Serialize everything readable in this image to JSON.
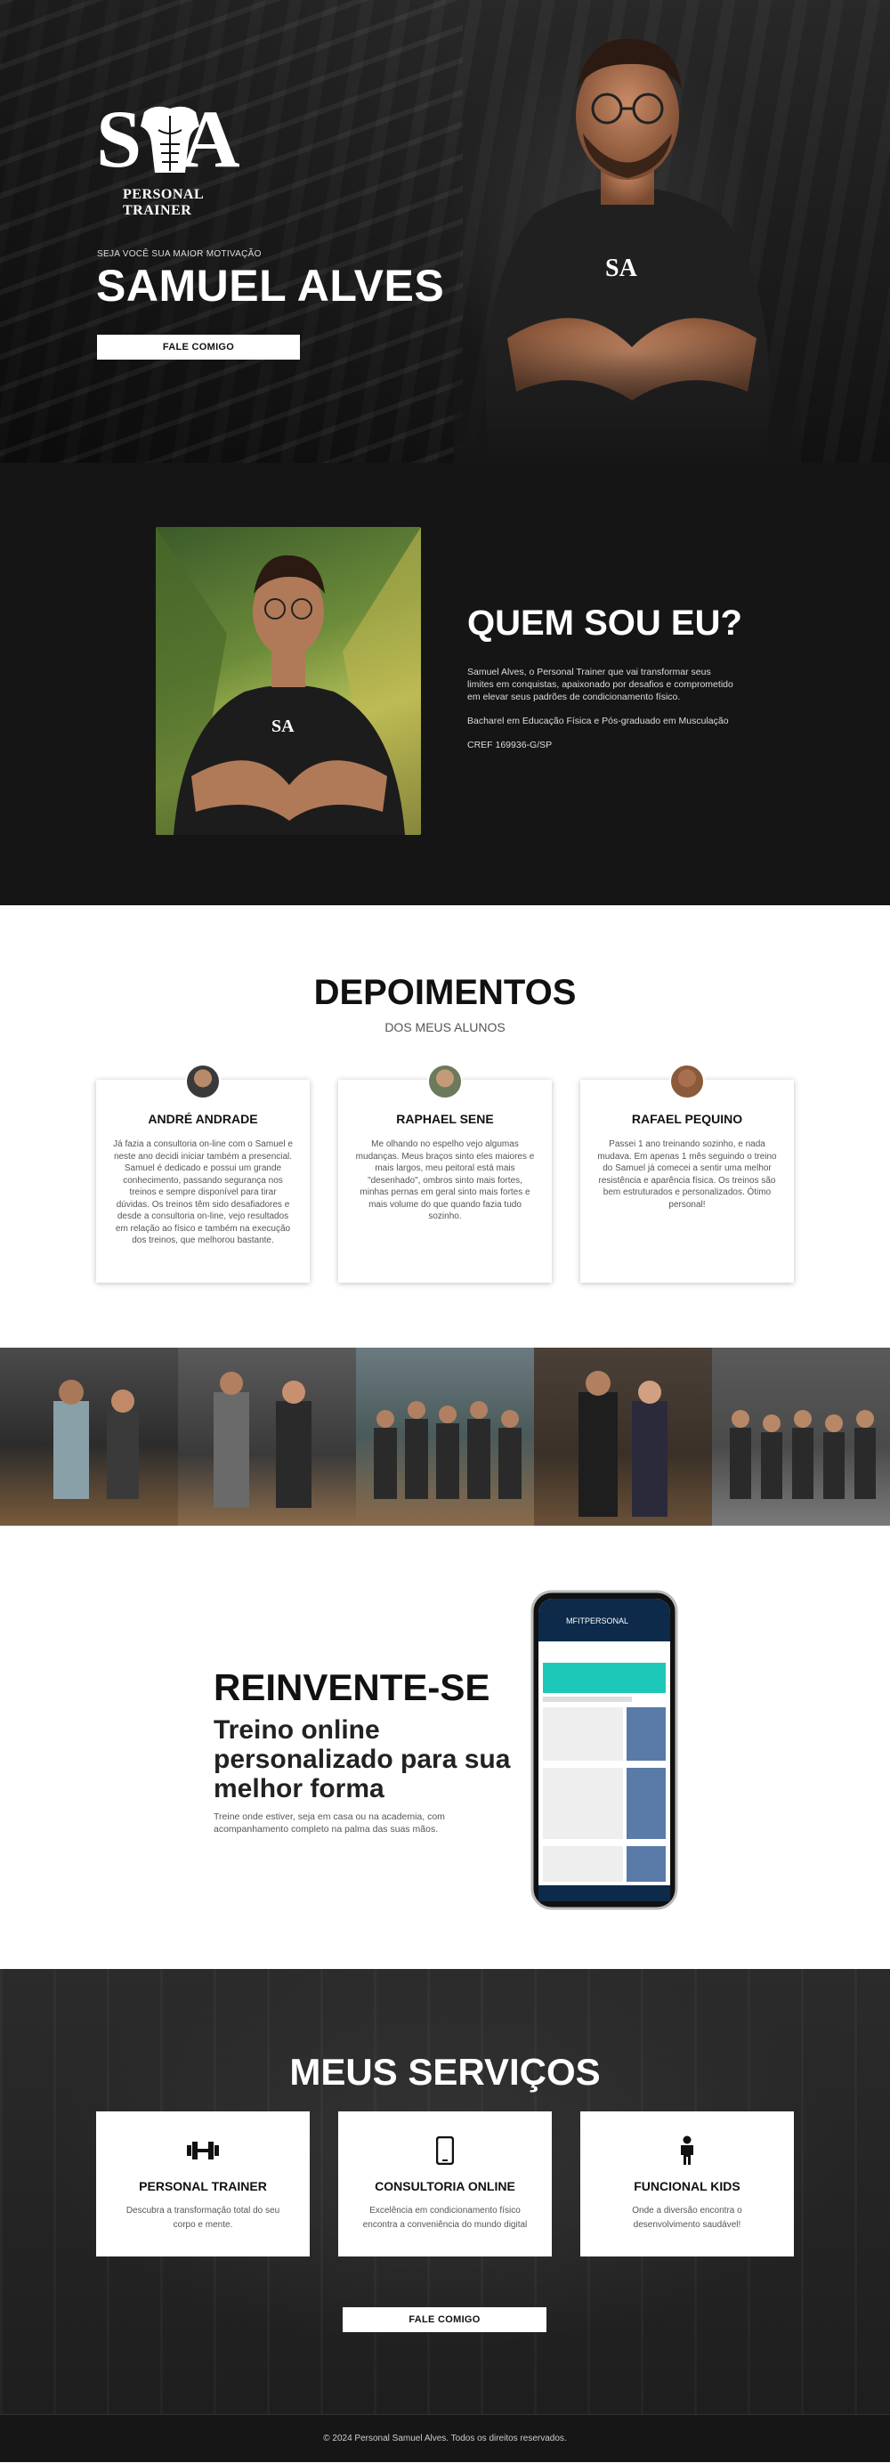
{
  "hero": {
    "logo_text": "SA",
    "logo_subtitle": "PERSONAL TRAINER",
    "tagline": "SEJA VOCÊ SUA MAIOR MOTIVAÇÃO",
    "name": "SAMUEL ALVES",
    "cta": "FALE COMIGO"
  },
  "about": {
    "title": "QUEM SOU EU?",
    "paragraph": "Samuel Alves, o Personal Trainer que vai transformar seus limites em conquistas, apaixonado por desafios e comprometido em elevar seus padrões de condicionamento físico.",
    "education": "Bacharel em Educação Física e Pós-graduado em Musculação",
    "cref": "CREF 169936-G/SP"
  },
  "testimonials": {
    "title": "DEPOIMENTOS",
    "subtitle": "DOS MEUS ALUNOS",
    "items": [
      {
        "name": "ANDRÉ ANDRADE",
        "text": "Já fazia a consultoria on-line com o Samuel e neste ano decidi iniciar também a presencial. Samuel é dedicado e possui um grande conhecimento, passando segurança nos treinos e sempre disponível para tirar dúvidas. Os treinos têm sido desafiadores e desde a consultoria on-line, vejo resultados em relação ao físico e também na execução dos treinos, que melhorou bastante."
      },
      {
        "name": "RAPHAEL SENE",
        "text": "Me olhando no espelho vejo algumas mudanças. Meus braços sinto eles maiores e mais largos, meu peitoral está mais \"desenhado\", ombros sinto mais fortes, minhas pernas em geral sinto mais fortes e mais volume do que quando fazia tudo sozinho."
      },
      {
        "name": "RAFAEL PEQUINO",
        "text": "Passei 1 ano treinando sozinho, e nada mudava. Em apenas 1 mês seguindo o treino do Samuel já comecei a sentir uma melhor resistência e aparência física. Os treinos são bem estruturados e personalizados. Ótimo personal!"
      }
    ]
  },
  "app": {
    "title": "REINVENTE-SE",
    "subtitle": "Treino online personalizado para sua melhor forma",
    "description": "Treine onde estiver, seja em casa ou na academia, com acompanhamento completo na palma das suas mãos.",
    "phone_brand": "MFITPERSONAL"
  },
  "services": {
    "title": "MEUS SERVIÇOS",
    "items": [
      {
        "icon": "dumbbell-icon",
        "title": "PERSONAL TRAINER",
        "desc": "Descubra a transformação total do seu corpo e mente."
      },
      {
        "icon": "smartphone-icon",
        "title": "CONSULTORIA ONLINE",
        "desc": "Excelência em condicionamento físico encontra a conveniência do mundo digital"
      },
      {
        "icon": "child-icon",
        "title": "FUNCIONAL KIDS",
        "desc": "Onde a diversão encontra o desenvolvimento saudável!"
      }
    ],
    "cta": "FALE COMIGO"
  },
  "footer": {
    "text": "© 2024 Personal Samuel Alves. Todos os direitos reservados."
  }
}
